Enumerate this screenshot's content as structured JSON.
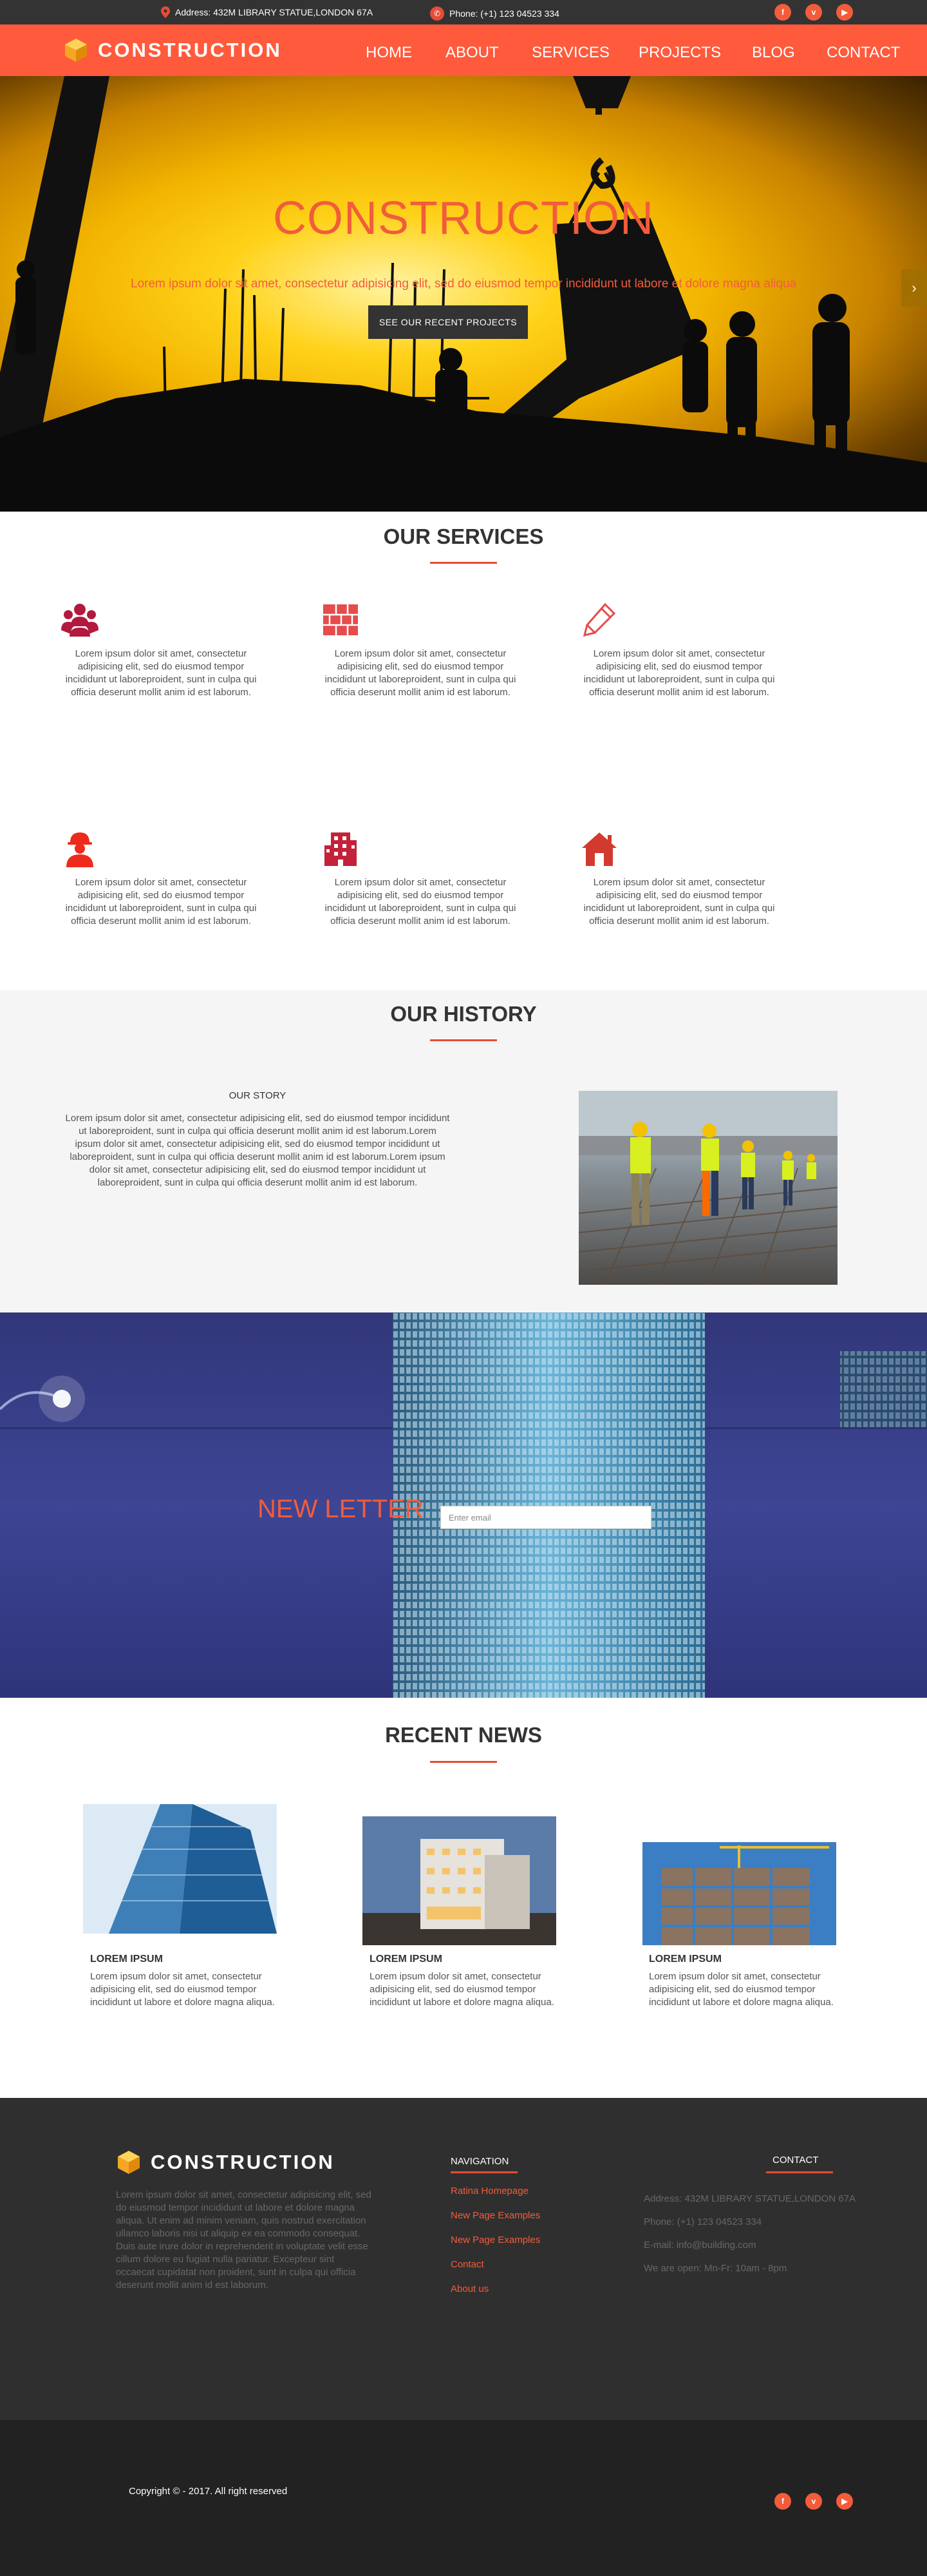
{
  "topbar": {
    "address": "Address: 432M LIBRARY STATUE,LONDON 67A",
    "phone": "Phone: (+1) 123 04523 334",
    "social": [
      {
        "icon": "facebook-icon",
        "glyph": "f"
      },
      {
        "icon": "vimeo-icon",
        "glyph": "v"
      },
      {
        "icon": "youtube-icon",
        "glyph": "▶"
      }
    ]
  },
  "brand": {
    "name": "CONSTRUCTION",
    "accent": "#ff5a3c",
    "dark": "#333333"
  },
  "nav": [
    "HOME",
    "ABOUT",
    "SERVICES",
    "PROJECTS",
    "BLOG",
    "CONTACT"
  ],
  "hero": {
    "title": "CONSTRUCTION",
    "subtitle": "Lorem ipsum dolor sit amet, consectetur adipisicing elit, sed do eiusmod tempor incididunt ut labore et dolore magna aliqua",
    "button": "SEE OUR RECENT PROJECTS",
    "next_arrow": "›"
  },
  "services": {
    "title": "OUR SERVICES",
    "items": [
      {
        "icon": "team-icon",
        "text": "Lorem ipsum dolor sit amet, consectetur adipisicing elit, sed do eiusmod tempor incididunt ut laboreproident, sunt in culpa qui officia deserunt mollit anim id est laborum."
      },
      {
        "icon": "brick-wall-icon",
        "text": "Lorem ipsum dolor sit amet, consectetur adipisicing elit, sed do eiusmod tempor incididunt ut laboreproident, sunt in culpa qui officia deserunt mollit anim id est laborum."
      },
      {
        "icon": "pencil-icon",
        "text": "Lorem ipsum dolor sit amet, consectetur adipisicing elit, sed do eiusmod tempor incididunt ut laboreproident, sunt in culpa qui officia deserunt mollit anim id est laborum."
      },
      {
        "icon": "worker-icon",
        "text": "Lorem ipsum dolor sit amet, consectetur adipisicing elit, sed do eiusmod tempor incididunt ut laboreproident, sunt in culpa qui officia deserunt mollit anim id est laborum."
      },
      {
        "icon": "building-icon",
        "text": "Lorem ipsum dolor sit amet, consectetur adipisicing elit, sed do eiusmod tempor incididunt ut laboreproident, sunt in culpa qui officia deserunt mollit anim id est laborum."
      },
      {
        "icon": "house-icon",
        "text": "Lorem ipsum dolor sit amet, consectetur adipisicing elit, sed do eiusmod tempor incididunt ut laboreproident, sunt in culpa qui officia deserunt mollit anim id est laborum."
      }
    ]
  },
  "history": {
    "title": "OUR HISTORY",
    "story_title": "OUR STORY",
    "story_text": "Lorem ipsum dolor sit amet, consectetur adipisicing elit, sed do eiusmod tempor incididunt ut laboreproident, sunt in culpa qui officia deserunt mollit anim id est laborum.Lorem ipsum dolor sit amet, consectetur adipisicing elit, sed do eiusmod tempor incididunt ut laboreproident, sunt in culpa qui officia deserunt mollit anim id est laborum.Lorem ipsum dolor sit amet, consectetur adipisicing elit, sed do eiusmod tempor incididunt ut laboreproident, sunt in culpa qui officia deserunt mollit anim id est laborum."
  },
  "newsletter": {
    "title": "NEW LETTER",
    "placeholder": "Enter email"
  },
  "news": {
    "title": "RECENT NEWS",
    "items": [
      {
        "title": "LOREM IPSUM",
        "text": "Lorem ipsum dolor sit amet, consectetur adipisicing elit, sed do eiusmod tempor incididunt ut labore et dolore magna aliqua."
      },
      {
        "title": "LOREM IPSUM",
        "text": "Lorem ipsum dolor sit amet, consectetur adipisicing elit, sed do eiusmod tempor incididunt ut labore et dolore magna aliqua."
      },
      {
        "title": "LOREM IPSUM",
        "text": "Lorem ipsum dolor sit amet, consectetur adipisicing elit, sed do eiusmod tempor incididunt ut labore et dolore magna aliqua."
      }
    ]
  },
  "footer": {
    "about": "Lorem ipsum dolor sit amet, consectetur adipisicing elit, sed do eiusmod tempor incididunt ut labore et dolore magna aliqua. Ut enim ad minim veniam, quis nostrud exercitation ullamco laboris nisi ut aliquip ex ea commodo consequat. Duis aute irure dolor in reprehenderit in voluptate velit esse cillum dolore eu fugiat nulla pariatur. Excepteur sint occaecat cupidatat non proident, sunt in culpa qui officia deserunt mollit anim id est laborum.",
    "nav_title": "NAVIGATION",
    "nav_links": [
      "Ratina Homepage",
      "New Page Examples",
      "New Page Examples",
      "Contact",
      "About us"
    ],
    "contact_title": "CONTACT",
    "contact_lines": [
      "Address: 432M LIBRARY STATUE,LONDON 67A",
      "Phone: (+1) 123 04523 334",
      "E-mail: info@building.com",
      "We are open: Mn-Fr: 10am - 8pm"
    ],
    "copyright": "Copyright © - 2017. All right reserved"
  }
}
